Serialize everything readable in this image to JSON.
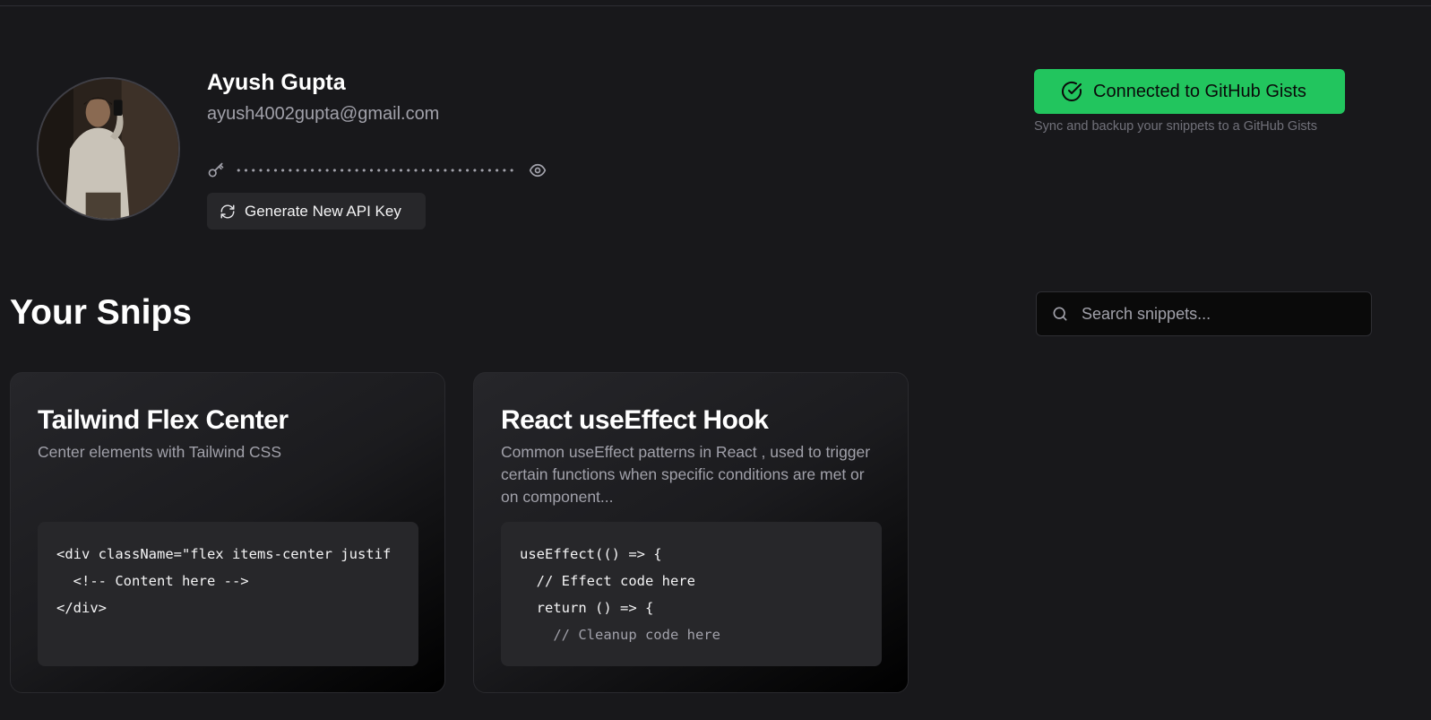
{
  "profile": {
    "name": "Ayush Gupta",
    "email": "ayush4002gupta@gmail.com",
    "api_key_masked": "••••••••••••••••••••••••••••••••••••••",
    "generate_button_label": "Generate New API Key",
    "avatar_alt": "Profile photo"
  },
  "github": {
    "button_label": "Connected to GitHub Gists",
    "description": "Sync and backup your snippets to a GitHub Gists",
    "accent_color": "#22c55e"
  },
  "snippets_section": {
    "title": "Your Snips",
    "search_placeholder": "Search snippets..."
  },
  "snippets": [
    {
      "title": "Tailwind Flex Center",
      "description": "Center elements with Tailwind CSS",
      "code_lines": [
        "<div className=\"flex items-center justif",
        "  <!-- Content here -->",
        "</div>"
      ]
    },
    {
      "title": "React useEffect Hook",
      "description": "Common useEffect patterns in React , used to trigger certain functions when specific conditions are met or on component...",
      "code_lines": [
        "useEffect(() => {",
        "  // Effect code here",
        "  return () => {",
        "    // Cleanup code here"
      ]
    }
  ],
  "icons": {
    "key": "key-icon",
    "eye": "eye-icon",
    "refresh": "refresh-icon",
    "check_circle": "check-circle-icon",
    "search": "search-icon"
  }
}
